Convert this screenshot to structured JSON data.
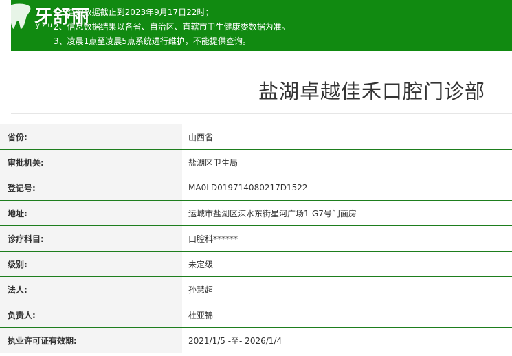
{
  "notice": {
    "lines": [
      "1、查询数据截止到2023年9月17日22时；",
      "2、信息数据结果以各省、自治区、直辖市卫生健康委数据为准。",
      "3、凌晨1点至凌晨5点系统进行维护，不能提供查询。"
    ]
  },
  "logo": {
    "text": "牙舒丽",
    "sub": "y z u"
  },
  "page": {
    "title": "盐湖卓越佳禾口腔门诊部"
  },
  "details": [
    {
      "label": "省份:",
      "value": "山西省"
    },
    {
      "label": "审批机关:",
      "value": "盐湖区卫生局"
    },
    {
      "label": "登记号:",
      "value": "MA0LD019714080217D1522"
    },
    {
      "label": "地址:",
      "value": "运城市盐湖区涑水东街星河广场1-G7号门面房"
    },
    {
      "label": "诊疗科目:",
      "value": "口腔科******"
    },
    {
      "label": "级别:",
      "value": "未定级"
    },
    {
      "label": "法人:",
      "value": "孙慧超"
    },
    {
      "label": "负责人:",
      "value": "杜亚锦"
    },
    {
      "label": "执业许可证有效期:",
      "value": "2021/1/5 -至- 2026/1/4"
    }
  ]
}
